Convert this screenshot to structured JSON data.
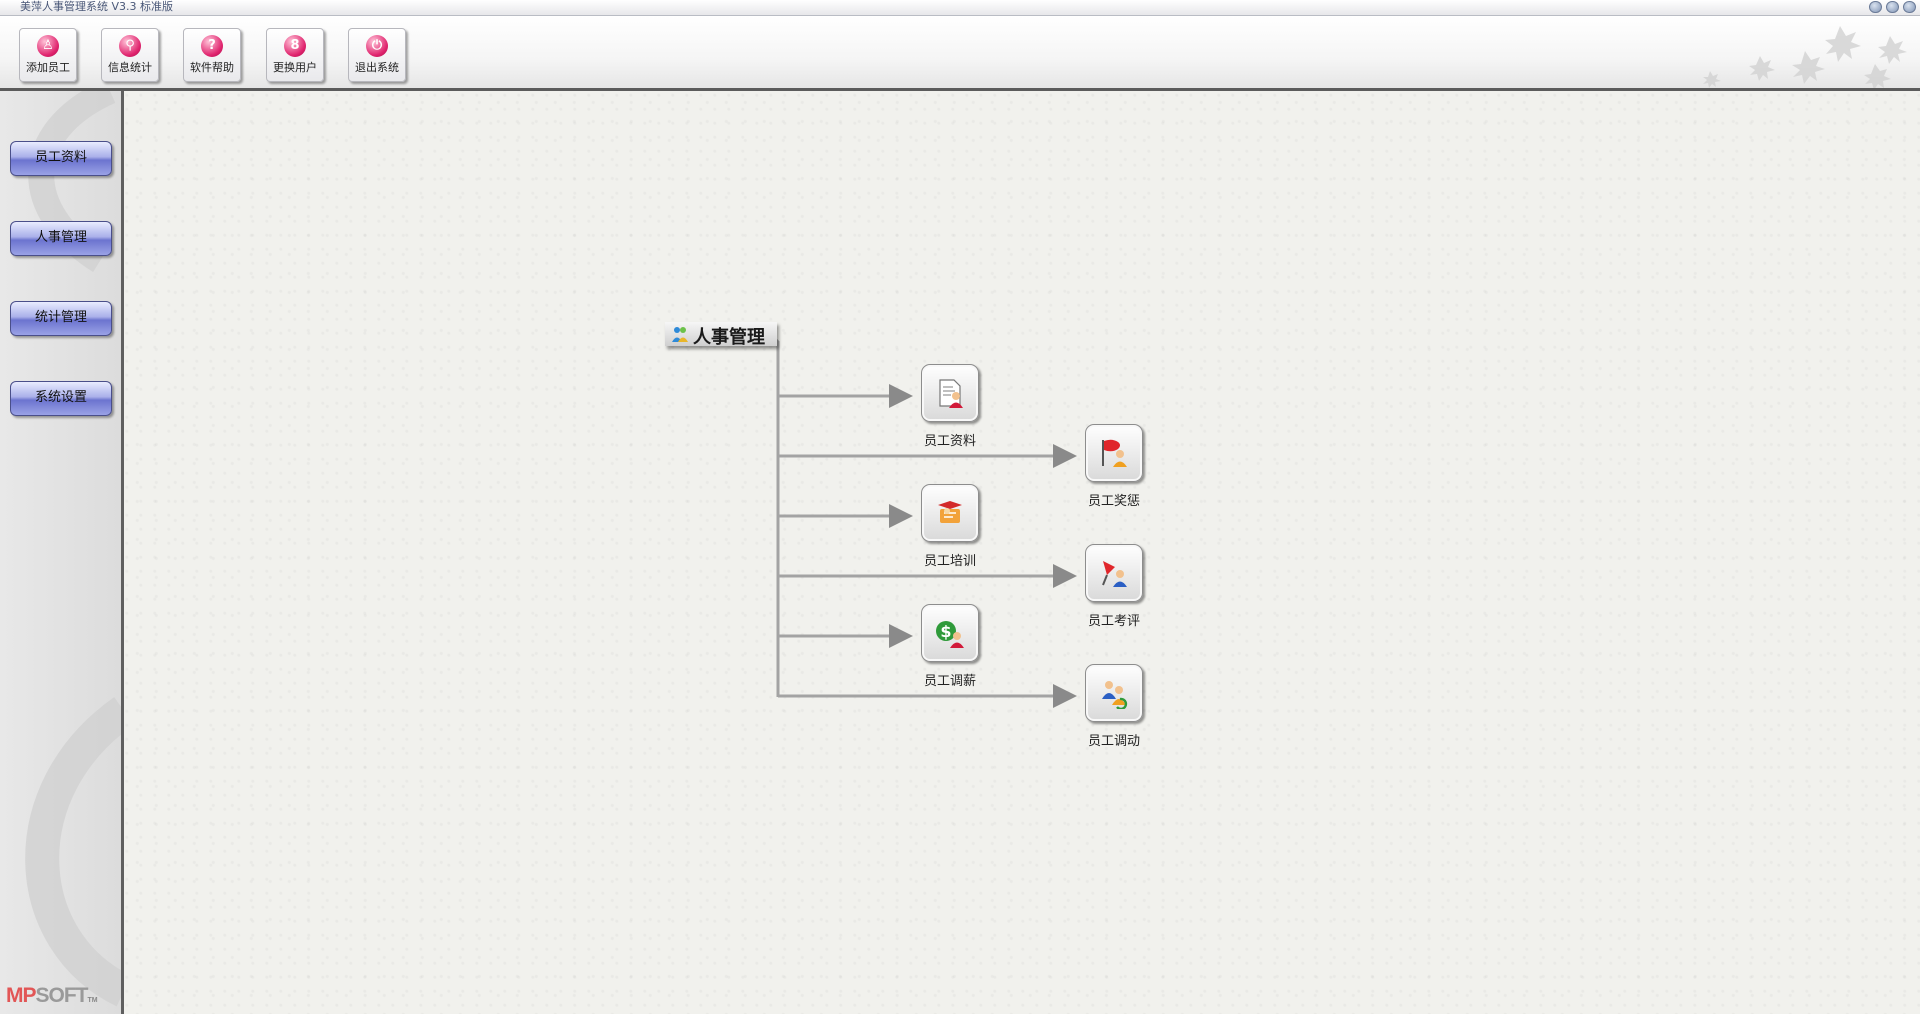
{
  "window": {
    "title": "美萍人事管理系统 V3.3 标准版"
  },
  "toolbar": {
    "buttons": [
      {
        "label": "添加员工",
        "icon": "add-user-icon",
        "glyph": "♙"
      },
      {
        "label": "信息统计",
        "icon": "search-icon",
        "glyph": "⚲"
      },
      {
        "label": "软件帮助",
        "icon": "help-icon",
        "glyph": "?"
      },
      {
        "label": "更换用户",
        "icon": "switch-user-icon",
        "glyph": "8"
      },
      {
        "label": "退出系统",
        "icon": "power-icon",
        "glyph": "⏻"
      }
    ]
  },
  "sidebar": {
    "items": [
      {
        "label": "员工资料"
      },
      {
        "label": "人事管理"
      },
      {
        "label": "统计管理"
      },
      {
        "label": "系统设置"
      }
    ],
    "logo": {
      "brand_a": "MP",
      "brand_b": "SOFT",
      "mark": "TM"
    }
  },
  "main": {
    "group_title": "人事管理",
    "nodes": [
      {
        "label": "员工资料",
        "icon": "employee-document-icon"
      },
      {
        "label": "员工奖惩",
        "icon": "employee-flag-icon"
      },
      {
        "label": "员工培训",
        "icon": "employee-training-icon"
      },
      {
        "label": "员工考评",
        "icon": "employee-evaluation-icon"
      },
      {
        "label": "员工调薪",
        "icon": "employee-salary-icon"
      },
      {
        "label": "员工调动",
        "icon": "employee-transfer-icon"
      }
    ]
  },
  "colors": {
    "accent_pink": "#e0246e",
    "sidebar_button": "#6c74cf",
    "connector": "#9a9a9a"
  }
}
